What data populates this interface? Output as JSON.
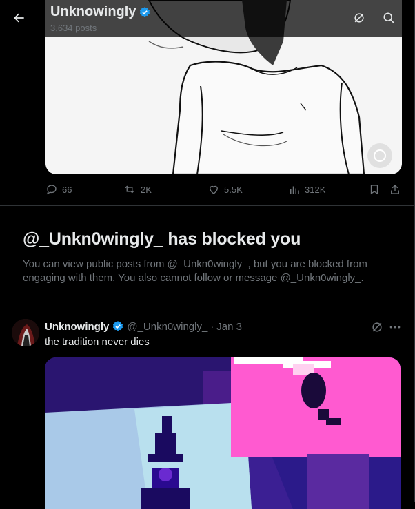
{
  "header": {
    "title": "Unknowingly",
    "subtitle": "3,634 posts"
  },
  "top_post": {
    "actions": {
      "replies": "66",
      "reposts": "2K",
      "likes": "5.5K",
      "views": "312K"
    }
  },
  "blocked": {
    "heading": "@_Unkn0wingly_ has blocked you",
    "body": "You can view public posts from @_Unkn0wingly_, but you are blocked from engaging with them. You also cannot follow or message @_Unkn0wingly_."
  },
  "post": {
    "name": "Unknowingly",
    "handle": "@_Unkn0wingly_",
    "separator": "·",
    "date": "Jan 3",
    "text": "the tradition never dies"
  },
  "colors": {
    "verified": "#1d9bf0",
    "muted": "#71767b",
    "text": "#e7e9ea",
    "background": "#000000"
  }
}
